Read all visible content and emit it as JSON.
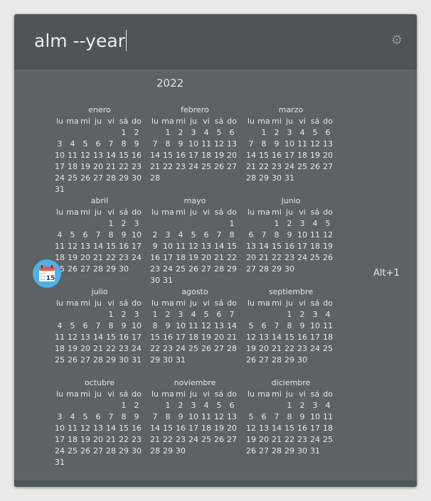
{
  "search": {
    "query": "alm --year"
  },
  "settings_icon": "gear-icon",
  "result": {
    "app_icon": "calendar-icon",
    "app_icon_day": "15",
    "shortcut": "Alt+1"
  },
  "calendar": {
    "year": "2022",
    "weekdays": [
      "lu",
      "ma",
      "mi",
      "ju",
      "vi",
      "sá",
      "do"
    ],
    "months": [
      {
        "name": "enero",
        "offset": 5,
        "days": 31
      },
      {
        "name": "febrero",
        "offset": 1,
        "days": 28
      },
      {
        "name": "marzo",
        "offset": 1,
        "days": 31
      },
      {
        "name": "abril",
        "offset": 4,
        "days": 30
      },
      {
        "name": "mayo",
        "offset": 6,
        "days": 31
      },
      {
        "name": "junio",
        "offset": 2,
        "days": 30
      },
      {
        "name": "julio",
        "offset": 4,
        "days": 31
      },
      {
        "name": "agosto",
        "offset": 0,
        "days": 31
      },
      {
        "name": "septiembre",
        "offset": 3,
        "days": 30
      },
      {
        "name": "octubre",
        "offset": 5,
        "days": 31
      },
      {
        "name": "noviembre",
        "offset": 1,
        "days": 30
      },
      {
        "name": "diciembre",
        "offset": 3,
        "days": 31
      }
    ]
  }
}
